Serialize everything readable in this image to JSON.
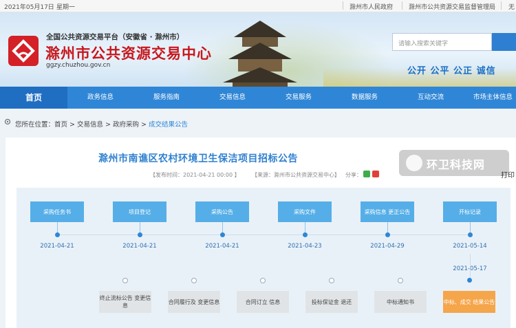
{
  "topbar": {
    "date": "2021年05月17日",
    "weekday": "星期一",
    "links": [
      "滁州市人民政府",
      "滁州市公共资源交易监督管理局",
      "无"
    ]
  },
  "header": {
    "platform": "全国公共资源交易平台（安徽省 · 滁州市）",
    "site_name": "滁州市公共资源交易中心",
    "domain": "ggzy.chuzhou.gov.cn",
    "search_placeholder": "请输入搜索关键字",
    "slogan": "公开  公平  公正  诚信"
  },
  "nav": {
    "items": [
      "首页",
      "政务信息",
      "服务指南",
      "交易信息",
      "交易服务",
      "数据服务",
      "互动交流",
      "市场主体信息"
    ]
  },
  "breadcrumb": {
    "prefix": "您所在位置：",
    "path": "首页 > 交易信息 > 政府采购 > ",
    "current": "成交结果公告"
  },
  "article": {
    "title": "滁州市南谯区农村环境卫生保洁项目招标公告",
    "publish_time": "【发布时间：2021-04-21 00:00 】",
    "source": "【来源：滁州市公共资源交易中心】",
    "share_label": "分享：",
    "print_label": "打印"
  },
  "watermark": {
    "text": "环卫科技网"
  },
  "process": {
    "steps": [
      {
        "label": "采购任务书",
        "date": "2021-04-21"
      },
      {
        "label": "项目登记",
        "date": "2021-04-21"
      },
      {
        "label": "采购公告",
        "date": "2021-04-21"
      },
      {
        "label": "采购文件",
        "date": "2021-04-23"
      },
      {
        "label": "采购信息 更正公告",
        "date": "2021-04-29"
      },
      {
        "label": "开标记录",
        "date": "2021-05-14"
      }
    ],
    "outcomes": [
      {
        "label": "终止流标公告 变更信息",
        "active": false
      },
      {
        "label": "合同履行及 变更信息",
        "active": false
      },
      {
        "label": "合同订立 信息",
        "active": false
      },
      {
        "label": "投标保证金 退还",
        "active": false
      },
      {
        "label": "中标通知书",
        "active": false
      },
      {
        "label": "中标、成交 结果公告",
        "active": true,
        "date": "2021-05-17"
      }
    ]
  },
  "colors": {
    "brand_red": "#c8161d",
    "nav_blue": "#2f86d6",
    "step_blue": "#55aee7",
    "active_orange": "#f5a54a"
  }
}
